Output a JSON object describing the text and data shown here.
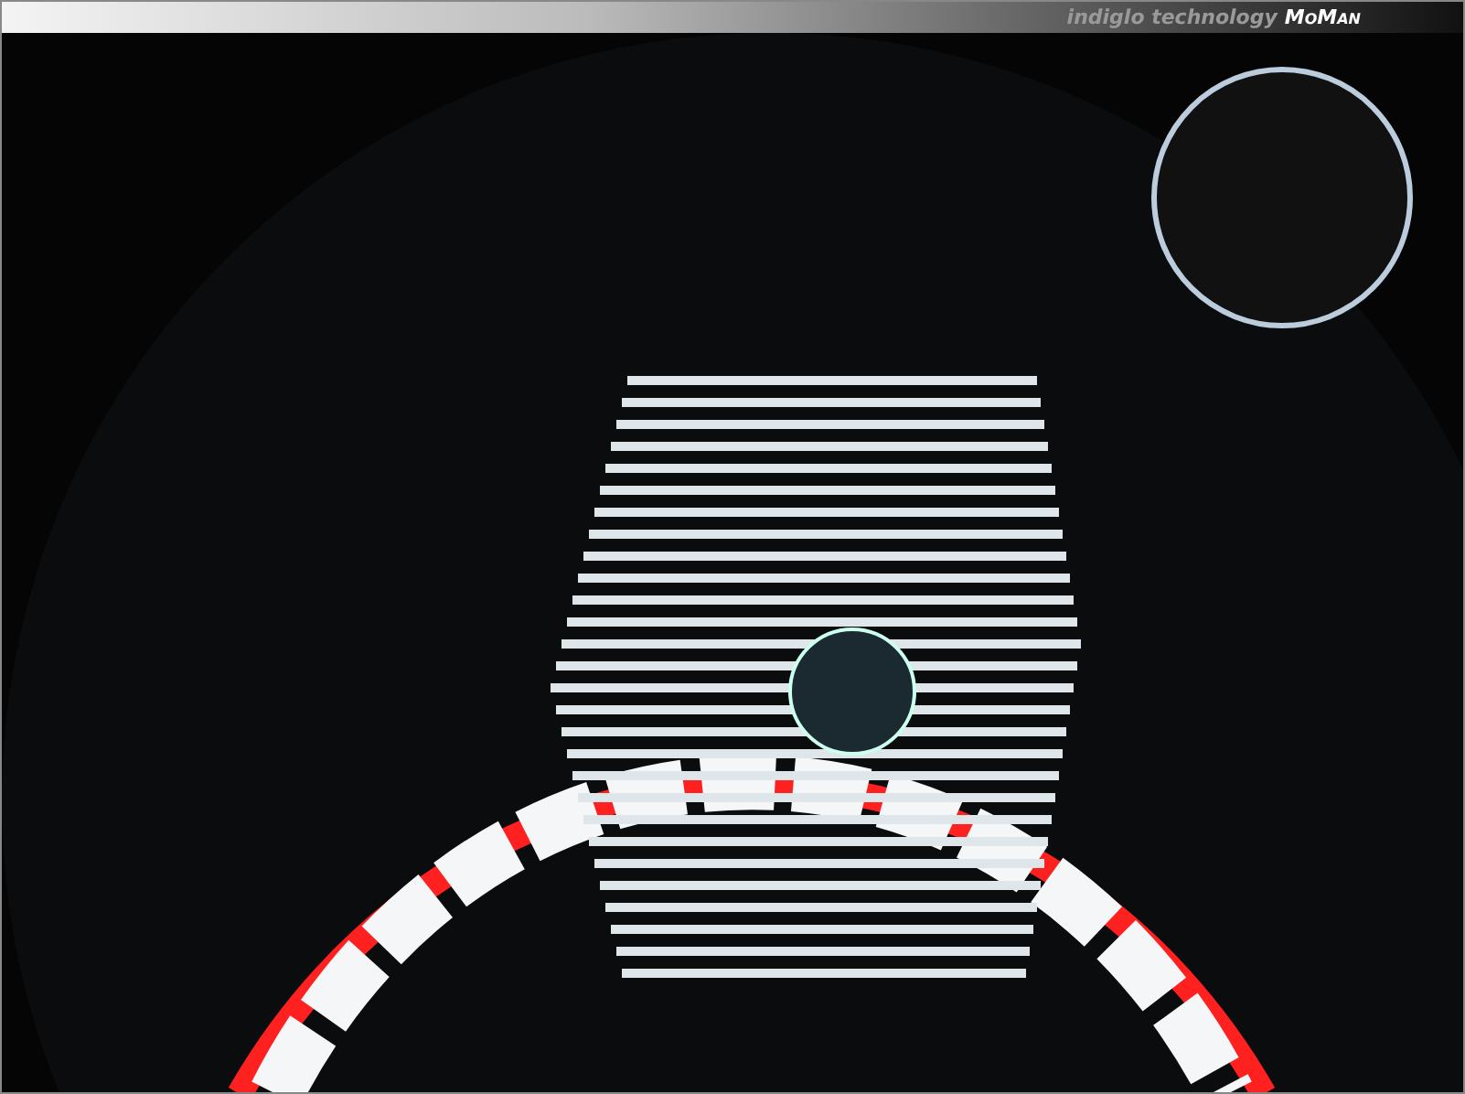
{
  "header": {
    "tagline": "indiglo technology",
    "brand": "MoMan"
  }
}
